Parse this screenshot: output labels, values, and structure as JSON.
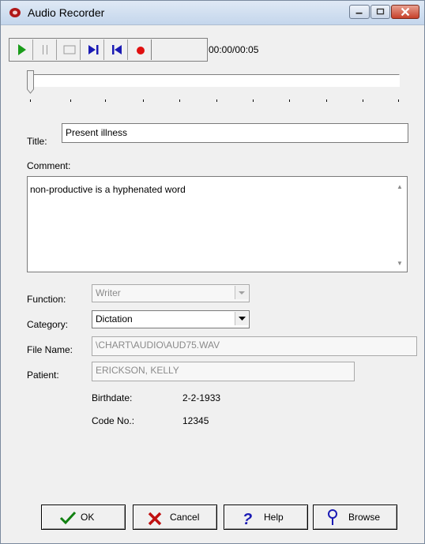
{
  "window": {
    "title": "Audio Recorder"
  },
  "player": {
    "time": "00:00/00:05"
  },
  "form": {
    "title_label": "Title:",
    "title_value": "Present illness",
    "comment_label": "Comment:",
    "comment_value": "non-productive is a hyphenated word",
    "function_label": "Function:",
    "function_value": "Writer",
    "category_label": "Category:",
    "category_value": "Dictation",
    "filename_label": "File Name:",
    "filename_value": "\\CHART\\AUDIO\\AUD75.WAV",
    "patient_label": "Patient:",
    "patient_value": "ERICKSON, KELLY",
    "birthdate_label": "Birthdate:",
    "birthdate_value": "2-2-1933",
    "code_label": "Code No.:",
    "code_value": "12345"
  },
  "buttons": {
    "ok": "OK",
    "cancel": "Cancel",
    "help": "Help",
    "browse": "Browse"
  },
  "colors": {
    "play": "#1a9c1a",
    "transport": "#1a1ab4",
    "record": "#e01010"
  }
}
